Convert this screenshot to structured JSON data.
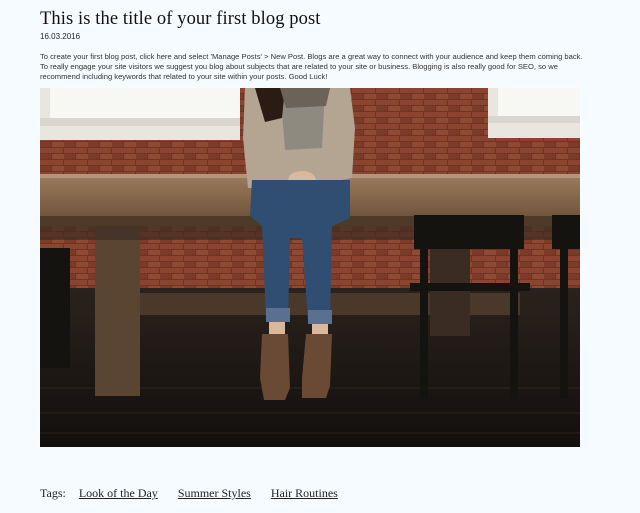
{
  "post": {
    "title": "This is the title of your first blog post",
    "date": "16.03.2016",
    "body": "To create your first blog post, click here and select 'Manage Posts' > New Post. Blogs are a great way to connect with your audience and keep them coming back. To really engage your site visitors we suggest you blog about subjects that are related to your site or business. Blogging is also really good for SEO, so we recommend including keywords that related to your site within your posts. Good Luck!"
  },
  "tags": {
    "label": "Tags:",
    "items": [
      "Look of the Day",
      "Summer Styles",
      "Hair Routines"
    ]
  },
  "colors": {
    "background": "#f6fbff",
    "brick": "#7a3a28",
    "table_wood": "#8a6a4e",
    "jeans": "#2f4e72"
  }
}
